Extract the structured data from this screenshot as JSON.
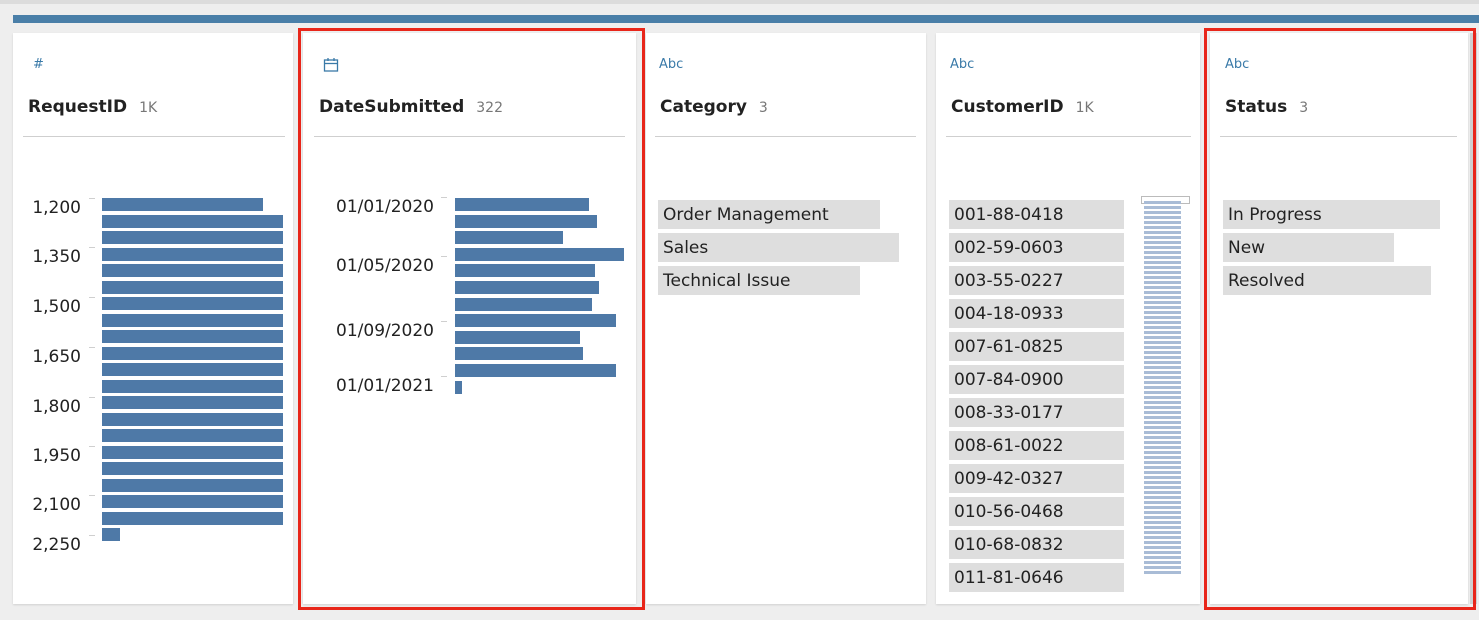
{
  "columns": {
    "request_id": {
      "icon": "number-icon",
      "icon_glyph": "#",
      "name": "RequestID",
      "count": "1K",
      "ticks": [
        "1,200",
        "1,350",
        "1,500",
        "1,650",
        "1,800",
        "1,950",
        "2,100",
        "2,250"
      ],
      "bars": [
        0.89,
        1,
        1,
        1,
        1,
        1,
        1,
        1,
        1,
        1,
        1,
        1,
        1,
        1,
        1,
        1,
        1,
        1,
        1,
        1,
        0.1
      ]
    },
    "date_submitted": {
      "icon": "calendar-icon",
      "icon_glyph": "📅",
      "name": "DateSubmitted",
      "count": "322",
      "ticks": [
        "01/01/2020",
        "01/05/2020",
        "01/09/2020",
        "01/01/2021"
      ],
      "bars": [
        0.79,
        0.84,
        0.64,
        1,
        0.83,
        0.85,
        0.81,
        0.95,
        0.74,
        0.76,
        0.95,
        0.04
      ]
    },
    "category": {
      "icon": "text-type-icon",
      "icon_glyph": "Abc",
      "name": "Category",
      "count": "3",
      "values": [
        {
          "label": "Order Management",
          "share": 0.92
        },
        {
          "label": "Sales",
          "share": 1.0
        },
        {
          "label": "Technical Issue",
          "share": 0.84
        }
      ]
    },
    "customer_id": {
      "icon": "text-type-icon",
      "icon_glyph": "Abc",
      "name": "CustomerID",
      "count": "1K",
      "values": [
        "001-88-0418",
        "002-59-0603",
        "003-55-0227",
        "004-18-0933",
        "007-61-0825",
        "007-84-0900",
        "008-33-0177",
        "008-61-0022",
        "009-42-0327",
        "010-56-0468",
        "010-68-0832",
        "011-81-0646"
      ]
    },
    "status": {
      "icon": "text-type-icon",
      "icon_glyph": "Abc",
      "name": "Status",
      "count": "3",
      "values": [
        {
          "label": "In Progress",
          "share": 1.0
        },
        {
          "label": "New",
          "share": 0.79
        },
        {
          "label": "Resolved",
          "share": 0.96
        }
      ]
    }
  },
  "colors": {
    "accent": "#4a7fa8",
    "bar": "#4e79a7",
    "category_fill": "#dedede",
    "highlight": "#e8261a"
  }
}
